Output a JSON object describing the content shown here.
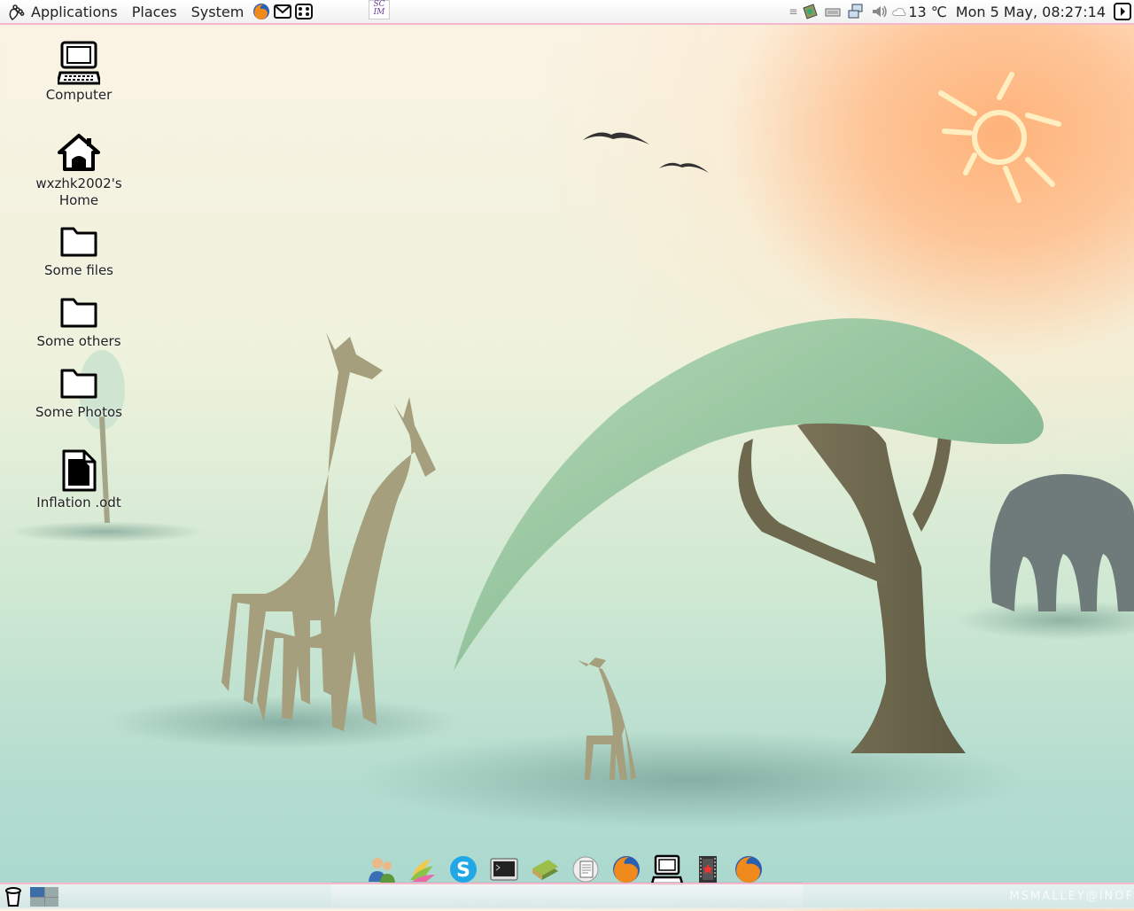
{
  "top_panel": {
    "menus": [
      "Applications",
      "Places",
      "System"
    ],
    "launchers": [
      "firefox-icon",
      "mail-icon",
      "screen-icon"
    ],
    "scim_label": "SC IM",
    "tray": {
      "weather_temp": "13 ℃",
      "clock": "Mon  5 May, 08:27:14"
    }
  },
  "desktop_icons": [
    {
      "label": "Computer",
      "icon": "computer-icon"
    },
    {
      "label": "wxzhk2002's Home",
      "icon": "home-icon"
    },
    {
      "label": "Some files",
      "icon": "folder-icon"
    },
    {
      "label": "Some others",
      "icon": "folder-icon"
    },
    {
      "label": "Some Photos",
      "icon": "folder-icon"
    },
    {
      "label": "Inflation .odt",
      "icon": "document-icon"
    }
  ],
  "dock": [
    "users-icon",
    "wallpaper-icon",
    "skype-icon",
    "terminal-icon",
    "books-icon",
    "document-viewer-icon",
    "firefox-icon",
    "computer-icon",
    "movie-icon",
    "firefox-icon"
  ],
  "watermark": "MSMALLEY@INOF",
  "colors": {
    "panel_border": "#f5b8cc",
    "sky": "#fbf3e4",
    "ground": "#a9d8cf",
    "sun": "#ffb27a"
  }
}
